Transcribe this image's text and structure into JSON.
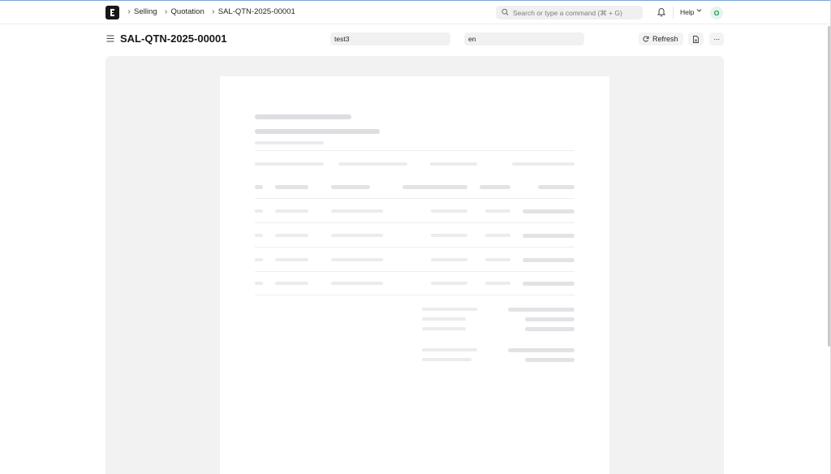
{
  "navbar": {
    "breadcrumbs": [
      "Selling",
      "Quotation",
      "SAL-QTN-2025-00001"
    ],
    "search_placeholder": "Search or type a command (⌘ + G)",
    "help_label": "Help",
    "avatar_initial": "O"
  },
  "page": {
    "title": "SAL-QTN-2025-00001",
    "print_format_value": "test3",
    "language_value": "en",
    "refresh_label": "Refresh",
    "more_label": "···"
  },
  "icons": {
    "search": "search-icon",
    "bell": "bell-icon",
    "refresh": "refresh-icon",
    "pdf": "pdf-icon",
    "menu": "hamburger-icon"
  },
  "colors": {
    "accent": "#171717",
    "avatar_bg": "#e4f5e9",
    "avatar_fg": "#278f5e",
    "canvas_bg": "#f2f2f2"
  }
}
